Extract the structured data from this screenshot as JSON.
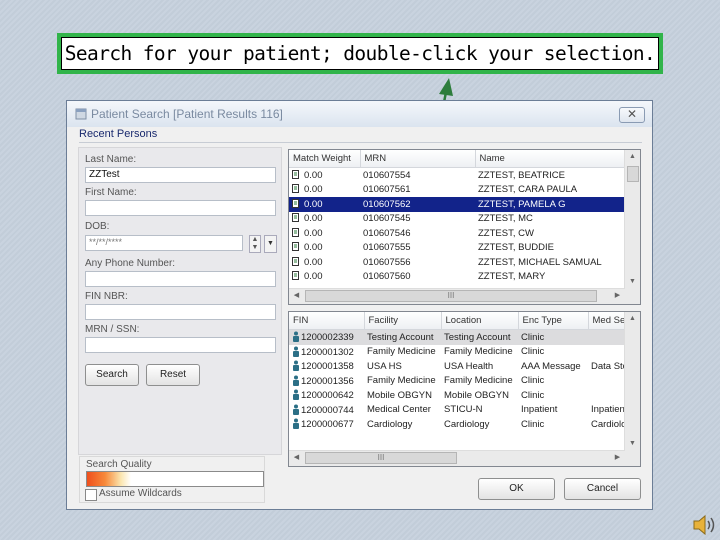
{
  "caption": "Search for your patient; double-click your selection.",
  "window": {
    "title": "Patient Search  [Patient Results 116]",
    "close_glyph": "✕",
    "section": "Recent Persons"
  },
  "form": {
    "last_name_label": "Last Name:",
    "last_name_value": "ZZTest",
    "first_name_label": "First Name:",
    "first_name_value": "",
    "dob_label": "DOB:",
    "dob_value": "**/**/****",
    "phone_label": "Any Phone Number:",
    "phone_value": "",
    "fin_label": "FIN NBR:",
    "fin_value": "",
    "mrn_label": "MRN / SSN:",
    "mrn_value": "",
    "search_button": "Search",
    "reset_button": "Reset",
    "search_quality_label": "Search Quality",
    "search_quality_level": 0.18,
    "wildcards_label": "Assume Wildcards",
    "wildcards_checked": false
  },
  "persons_grid": {
    "columns": [
      "Match Weight",
      "MRN",
      "Name"
    ],
    "selected_row": 2,
    "rows": [
      {
        "weight": "0.00",
        "mrn": "010607554",
        "name": "ZZTEST, BEATRICE"
      },
      {
        "weight": "0.00",
        "mrn": "010607561",
        "name": "ZZTEST, CARA PAULA"
      },
      {
        "weight": "0.00",
        "mrn": "010607562",
        "name": "ZZTEST, PAMELA G"
      },
      {
        "weight": "0.00",
        "mrn": "010607545",
        "name": "ZZTEST, MC"
      },
      {
        "weight": "0.00",
        "mrn": "010607546",
        "name": "ZZTEST, CW"
      },
      {
        "weight": "0.00",
        "mrn": "010607555",
        "name": "ZZTEST, BUDDIE"
      },
      {
        "weight": "0.00",
        "mrn": "010607556",
        "name": "ZZTEST, MICHAEL SAMUAL"
      },
      {
        "weight": "0.00",
        "mrn": "010607560",
        "name": "ZZTEST, MARY"
      }
    ],
    "hscroll_glyph": "III"
  },
  "encounters_grid": {
    "columns": [
      "FIN",
      "Facility",
      "Location",
      "Enc Type",
      "Med Service"
    ],
    "highlighted_row": 0,
    "rows": [
      {
        "fin": "1200002339",
        "facility": "Testing Account",
        "location": "Testing Account",
        "enc_type": "Clinic",
        "med_service": ""
      },
      {
        "fin": "1200001302",
        "facility": "Family Medicine",
        "location": "Family Medicine",
        "enc_type": "Clinic",
        "med_service": ""
      },
      {
        "fin": "1200001358",
        "facility": "USA HS",
        "location": "USA Health",
        "enc_type": "AAA Message",
        "med_service": "Data Storage"
      },
      {
        "fin": "1200001356",
        "facility": "Family Medicine",
        "location": "Family Medicine",
        "enc_type": "Clinic",
        "med_service": ""
      },
      {
        "fin": "1200000642",
        "facility": "Mobile OBGYN",
        "location": "Mobile OBGYN",
        "enc_type": "Clinic",
        "med_service": ""
      },
      {
        "fin": "1200000744",
        "facility": "Medical Center",
        "location": "STICU-N",
        "enc_type": "Inpatient",
        "med_service": "Inpatient"
      },
      {
        "fin": "1200000677",
        "facility": "Cardiology",
        "location": "Cardiology",
        "enc_type": "Clinic",
        "med_service": "Cardiology C"
      }
    ],
    "hscroll_glyph": "III"
  },
  "footer": {
    "ok_button": "OK",
    "cancel_button": "Cancel"
  },
  "colors": {
    "caption_border": "#31b44a",
    "arrow": "#2d7d3c",
    "selection": "#12238a"
  },
  "icons": [
    "dialog-icon",
    "close-icon",
    "person-icon",
    "encounter-icon",
    "speaker-icon"
  ]
}
